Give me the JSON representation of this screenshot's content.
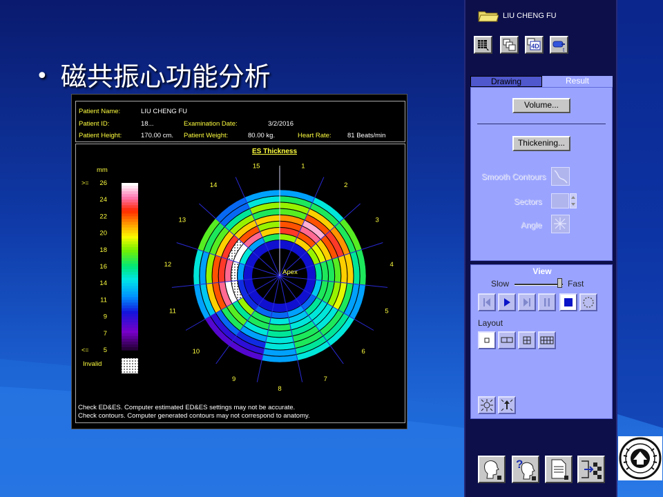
{
  "slide": {
    "bullet": "•",
    "title": "磁共振心功能分析"
  },
  "patient": {
    "name_label": "Patient Name:",
    "name": "LIU CHENG FU",
    "id_label": "Patient ID:",
    "id": "18...",
    "exam_label": "Examination Date:",
    "exam_date": "3/2/2016",
    "height_label": "Patient Height:",
    "height": "170.00 cm.",
    "weight_label": "Patient Weight:",
    "weight": "80.00 kg.",
    "hr_label": "Heart Rate:",
    "heart_rate": "81 Beats/min"
  },
  "colorbar": {
    "unit": "mm",
    "ge": ">=",
    "le": "<=",
    "ticks": [
      "26",
      "24",
      "22",
      "20",
      "18",
      "16",
      "14",
      "11",
      "9",
      "7",
      "5"
    ],
    "invalid_label": "Invalid"
  },
  "chart_data": {
    "type": "heatmap",
    "title": "ES Thickness",
    "center_label": "Apex",
    "sector_labels": [
      "15",
      "1",
      "2",
      "3",
      "4",
      "5",
      "6",
      "7",
      "8",
      "9",
      "10",
      "11",
      "12",
      "13",
      "14"
    ],
    "value_range": [
      5,
      26
    ],
    "rings": [
      {
        "name": "ring1",
        "values": [
          12,
          12,
          14,
          17,
          16,
          12,
          14,
          14,
          12,
          8,
          8,
          12,
          14,
          17,
          11
        ]
      },
      {
        "name": "ring2",
        "values": [
          14,
          16,
          16,
          16,
          15,
          12,
          15,
          15,
          12,
          9,
          9,
          13,
          12,
          16,
          11
        ]
      },
      {
        "name": "ring3",
        "values": [
          18,
          18,
          20,
          21,
          20,
          16,
          16,
          16,
          14,
          10,
          11,
          20,
          18,
          17,
          15
        ]
      },
      {
        "name": "ring4",
        "values": [
          16,
          17,
          22,
          23,
          20,
          19,
          14,
          16,
          14,
          12,
          16,
          22,
          22,
          20,
          18
        ]
      },
      {
        "name": "ring5",
        "values": [
          20,
          21,
          25,
          22,
          17,
          18,
          14,
          15,
          15,
          14,
          17,
          24,
          23,
          23,
          20
        ]
      },
      {
        "name": "ring6",
        "values": [
          18,
          22,
          24,
          20,
          16,
          16,
          14,
          14,
          16,
          16,
          15,
          26,
          24,
          "invalid",
          22
        ]
      },
      {
        "name": "ring7",
        "values": [
          20,
          23,
          22,
          19,
          16,
          16,
          15,
          13,
          14,
          16,
          18,
          "invalid",
          "invalid",
          26,
          24
        ]
      },
      {
        "name": "ring8",
        "values": [
          16,
          18,
          20,
          18,
          15,
          13,
          11,
          12,
          11,
          11,
          10,
          10,
          12,
          14,
          12
        ]
      }
    ]
  },
  "messages": [
    "Check ED&ES. Computer estimated ED&ES settings may not be accurate.",
    "Check contours. Computer generated contours may not correspond to anatomy."
  ],
  "panel": {
    "user": "LIU CHENG FU",
    "tabs": [
      "Drawing",
      "Result"
    ],
    "volume_button": "Volume...",
    "thickening_button": "Thickening...",
    "smooth_contours": "Smooth Contours",
    "sectors": "Sectors",
    "angle": "Angle",
    "view_title": "View",
    "slow": "Slow",
    "fast": "Fast",
    "layout": "Layout",
    "toolbar_4d": "4D",
    "toolbar_t": "t",
    "help_mark": "?"
  },
  "colors": {
    "slide_bg_top": "#0a1a6e",
    "panel_bg": "#0c0f4a",
    "panel_box": "#9aa4ff",
    "label_yellow": "#ffff40"
  }
}
